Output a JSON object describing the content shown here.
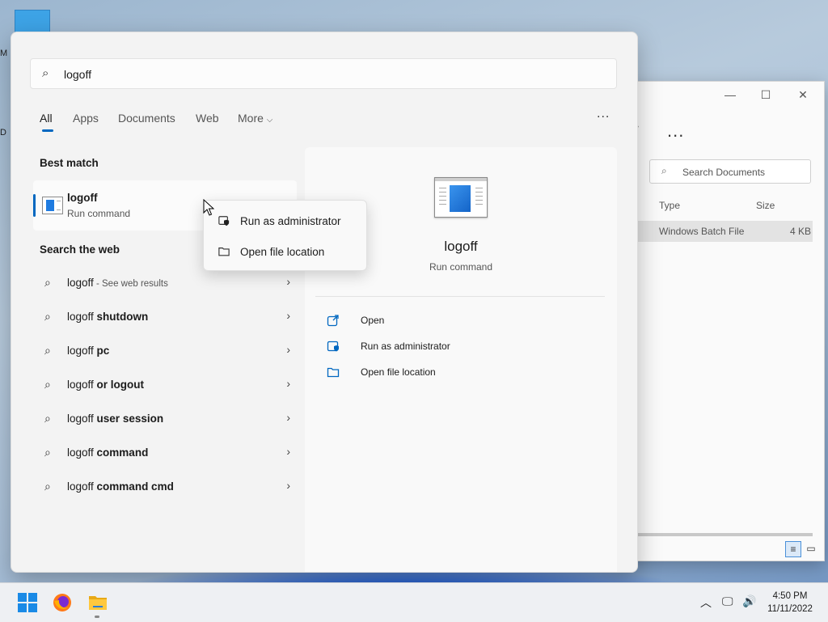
{
  "desktop": {
    "icon_label_1": "M",
    "icon_label_2": "D"
  },
  "explorer": {
    "minimize_glyph": "—",
    "maximize_glyph": "☐",
    "close_glyph": "✕",
    "more_glyph": "...",
    "search_placeholder": "Search Documents",
    "col_type": "Type",
    "col_size": "Size",
    "row_type": "Windows Batch File",
    "row_size": "4 KB"
  },
  "search": {
    "query": "logoff",
    "tabs": [
      {
        "label": "All",
        "active": true
      },
      {
        "label": "Apps"
      },
      {
        "label": "Documents"
      },
      {
        "label": "Web"
      },
      {
        "label": "More"
      }
    ],
    "more_dots": "...",
    "best_match_title": "Best match",
    "best_match": {
      "name": "logoff",
      "sub": "Run command"
    },
    "web_title": "Search the web",
    "web_items": [
      {
        "prefix": "logoff",
        "bold": "",
        "suffix": " - See web results"
      },
      {
        "prefix": "logoff ",
        "bold": "shutdown",
        "suffix": ""
      },
      {
        "prefix": "logoff ",
        "bold": "pc",
        "suffix": ""
      },
      {
        "prefix": "logoff ",
        "bold": "or logout",
        "suffix": ""
      },
      {
        "prefix": "logoff ",
        "bold": "user session",
        "suffix": ""
      },
      {
        "prefix": "logoff ",
        "bold": "command",
        "suffix": ""
      },
      {
        "prefix": "logoff ",
        "bold": "command cmd",
        "suffix": ""
      }
    ],
    "preview": {
      "name": "logoff",
      "sub": "Run command",
      "actions": [
        "Open",
        "Run as administrator",
        "Open file location"
      ]
    },
    "context_menu": [
      "Run as administrator",
      "Open file location"
    ]
  },
  "taskbar": {
    "time": "4:50 PM",
    "date": "11/11/2022"
  },
  "colors": {
    "accent": "#0067c0",
    "panel_bg": "#f3f3f3"
  }
}
